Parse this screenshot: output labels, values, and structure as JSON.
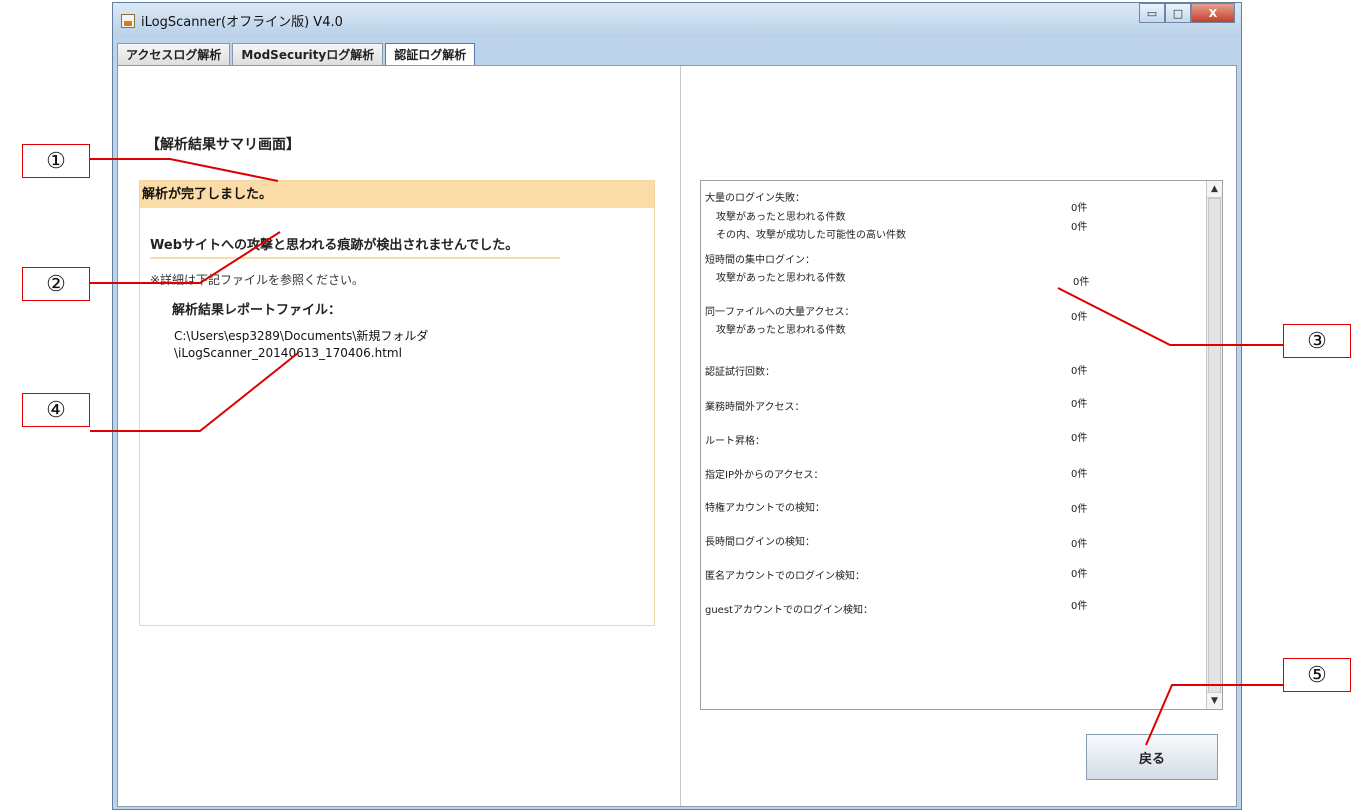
{
  "window": {
    "title": "iLogScanner(オフライン版) V4.0",
    "controls": {
      "minimize": "▭",
      "maximize": "□",
      "close": "X"
    }
  },
  "tabs": [
    "アクセスログ解析",
    "ModSecurityログ解析",
    "認証ログ解析"
  ],
  "active_tab": "認証ログ解析",
  "summary": {
    "heading": "【解析結果サマリ画面】",
    "status": "解析が完了しました。",
    "main_message": "Webサイトへの攻撃と思われる痕跡が検出されませんでした。",
    "note": "※詳細は下記ファイルを参照ください。",
    "report_label": "解析結果レポートファイル：",
    "report_path_1": "C:\\Users\\esp3289\\Documents\\新規フォルダ",
    "report_path_2": "\\iLogScanner_20140613_170406.html"
  },
  "stats": {
    "mass_login_fail": "大量のログイン失敗：",
    "mass_login_attack": "攻撃があったと思われる件数",
    "mass_login_attack_count": "0件",
    "mass_login_success": "その内、攻撃が成功した可能性の高い件数",
    "mass_login_success_count": "0件",
    "burst_login": "短時間の集中ログイン：",
    "burst_login_attack": "攻撃があったと思われる件数",
    "burst_login_count": "0件",
    "same_file": "同一ファイルへの大量アクセス：",
    "same_file_count": "0件",
    "same_file_attack": "攻撃があったと思われる件数",
    "auth_attempts": "認証試行回数：",
    "auth_attempts_count": "0件",
    "off_hours": "業務時間外アクセス：",
    "off_hours_count": "0件",
    "root_escalation": "ルート昇格：",
    "root_escalation_count": "0件",
    "non_designated_ip": "指定IP外からのアクセス：",
    "non_designated_ip_count": "0件",
    "privileged_account": "特権アカウントでの検知：",
    "privileged_account_count": "0件",
    "long_login": "長時間ログインの検知：",
    "long_login_count": "0件",
    "anonymous_login": "匿名アカウントでのログイン検知：",
    "anonymous_login_count": "0件",
    "guest_login": "guestアカウントでのログイン検知：",
    "guest_login_count": "0件"
  },
  "scrollbar": {
    "up": "▲",
    "down": "▼"
  },
  "buttons": {
    "back": "戻る"
  },
  "callouts": [
    "①",
    "②",
    "③",
    "④",
    "⑤"
  ],
  "colors": {
    "header_bg": "#fcdca6",
    "panel_border": "#f1d5a8",
    "callout_red": "#dd0000",
    "titlebar": "#b9d0e8"
  }
}
